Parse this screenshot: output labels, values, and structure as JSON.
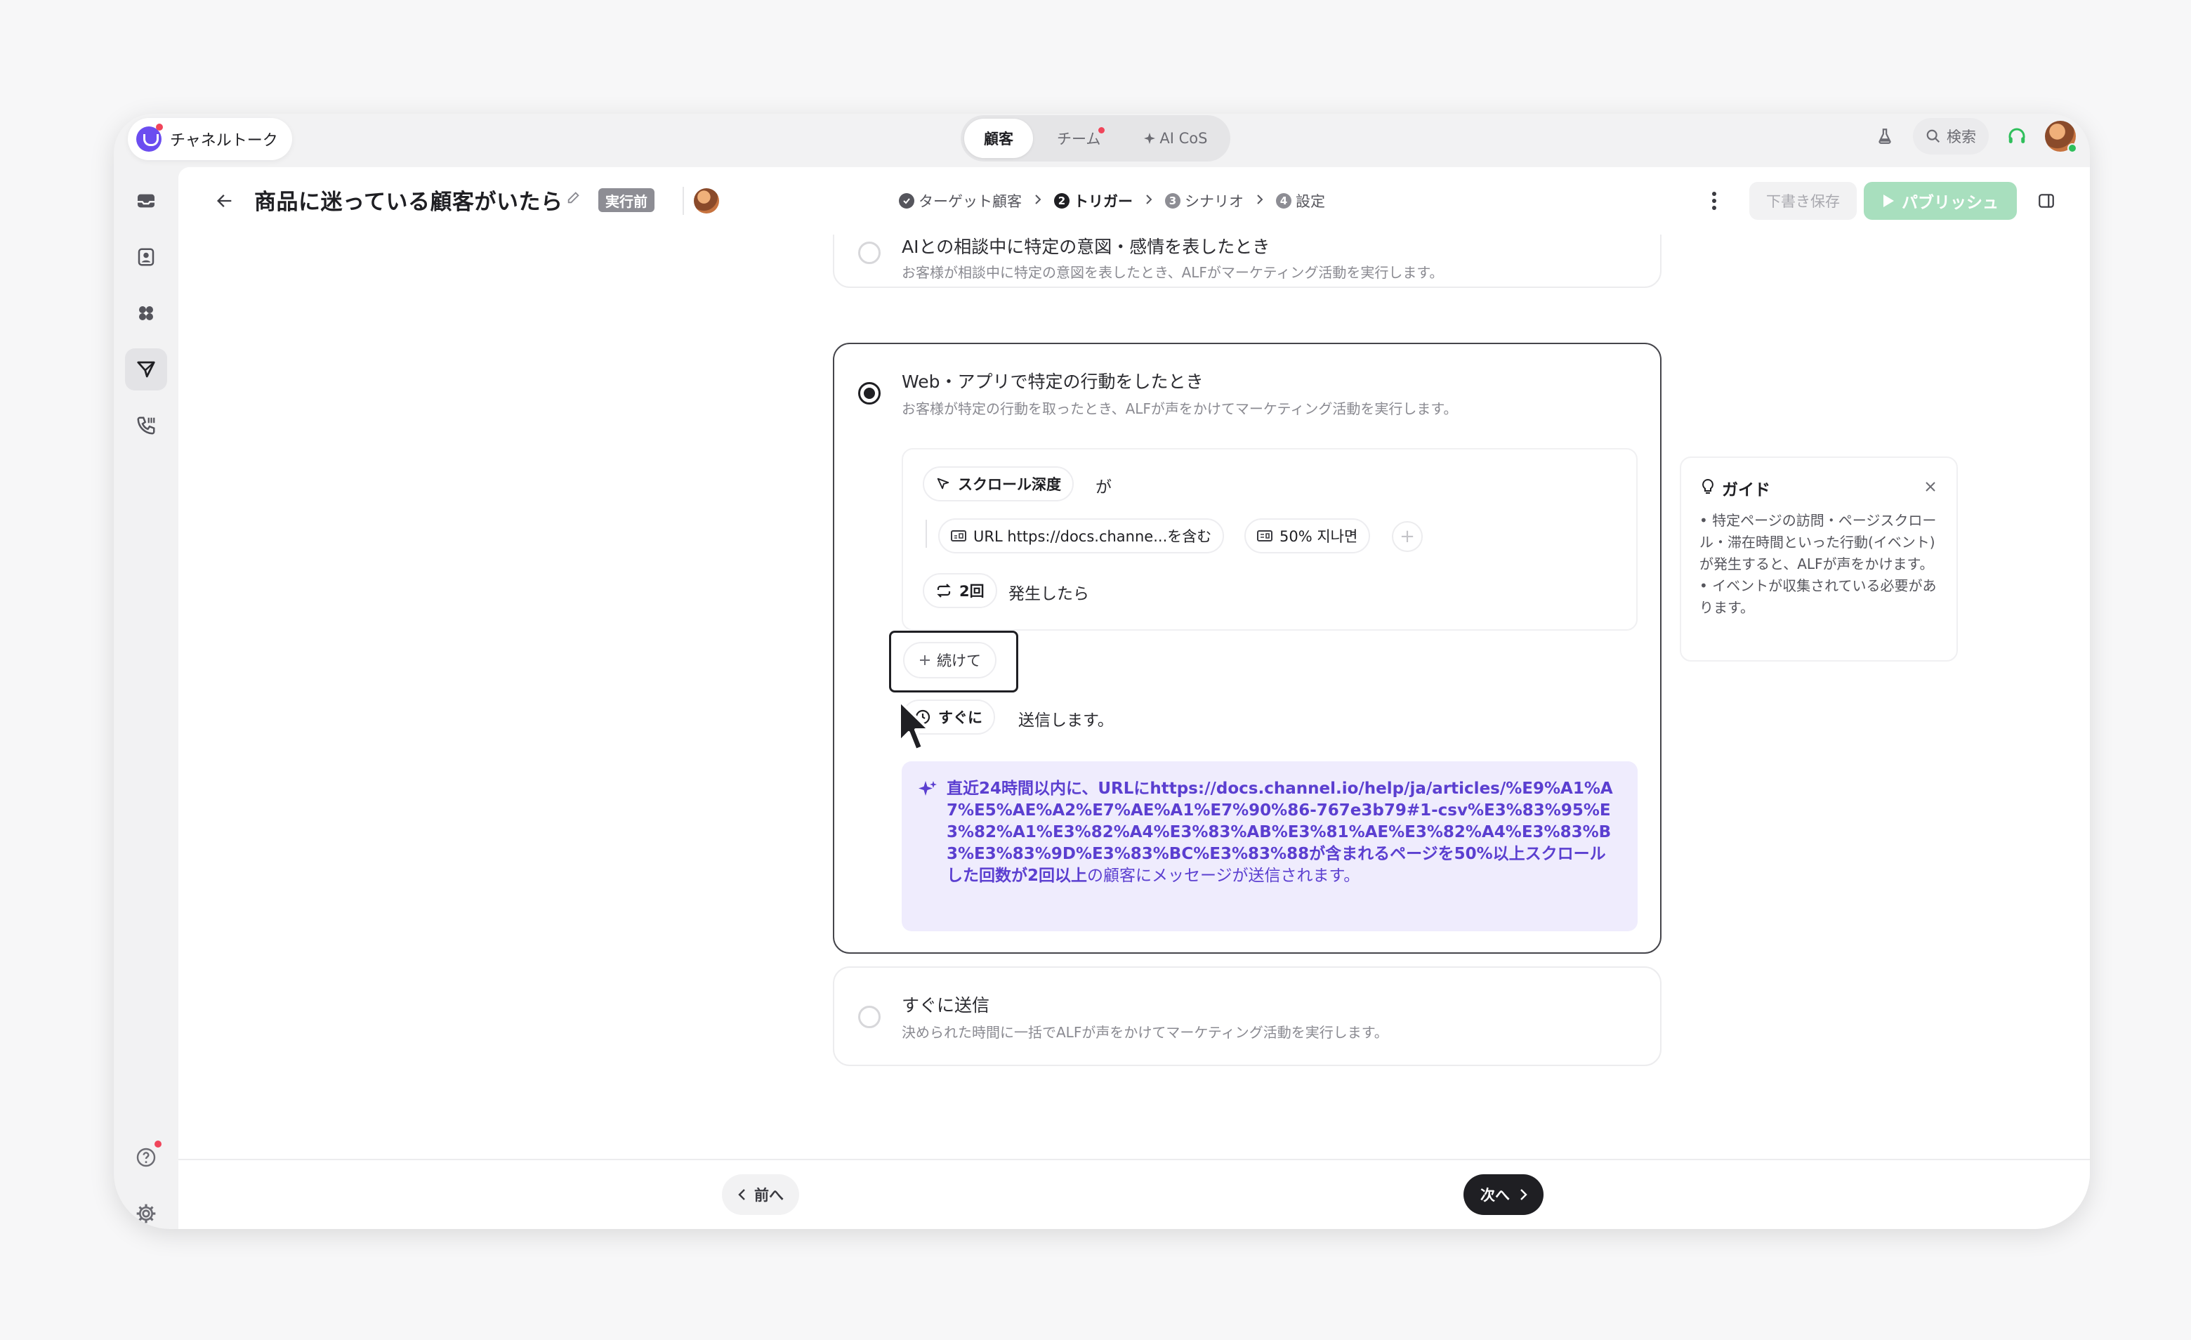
{
  "brand": {
    "name": "チャネルトーク"
  },
  "top_tabs": [
    {
      "label": "顧客",
      "active": true
    },
    {
      "label": "チーム",
      "has_dot": true
    },
    {
      "label": "AI CoS",
      "icon": "sparkle-icon"
    }
  ],
  "top_right": {
    "search_label": "検索"
  },
  "header": {
    "title": "商品に迷っている顧客がいたら",
    "status": "実行前",
    "steps": [
      {
        "label": "ターゲット顧客",
        "state": "done"
      },
      {
        "num": "2",
        "label": "トリガー",
        "state": "current"
      },
      {
        "num": "3",
        "label": "シナリオ",
        "state": "todo"
      },
      {
        "num": "4",
        "label": "設定",
        "state": "todo"
      }
    ],
    "draft_label": "下書き保存",
    "publish_label": "パブリッシュ"
  },
  "options": [
    {
      "title": "AIとの相談中に特定の意図・感情を表したとき",
      "desc": "お客様が相談中に特定の意図を表したとき、ALFがマーケティング活動を実行します。",
      "selected": false
    },
    {
      "title": "Web・アプリで特定の行動をしたとき",
      "desc": "お客様が特定の行動を取ったとき、ALFが声をかけてマーケティング活動を実行します。",
      "selected": true
    },
    {
      "title": "すぐに送信",
      "desc": "決められた時間に一括でALFが声をかけてマーケティング活動を実行します。",
      "selected": false
    }
  ],
  "condition": {
    "event_label": "スクロール深度",
    "event_suffix": "が",
    "filter_url": "URL https://docs.channe...を含む",
    "filter_depth": "50% 지나면",
    "count_label": "2回",
    "count_suffix": "発生したら",
    "continue_label": "続けて",
    "timing_label": "すぐに",
    "timing_suffix": "送信します。"
  },
  "summary": {
    "bold_part": "直近24時間以内に、URLにhttps://docs.channel.io/help/ja/articles/%E9%A1%A7%E5%AE%A2%E7%AE%A1%E7%90%86-767e3b79#1-csv%E3%83%95%E3%82%A1%E3%82%A4%E3%83%AB%E3%81%AE%E3%82%A4%E3%83%B3%E3%83%9D%E3%83%BC%E3%83%88が含まれるページを50%以上スクロールした回数が2回以上",
    "normal_part": "の顧客にメッセージが送信されます。"
  },
  "guide": {
    "title": "ガイド",
    "body_1": "• 特定ページの訪問・ページスクロール・滞在時間といった行動(イベント)が発生すると、ALFが声をかけます。",
    "body_2": "• イベントが収集されている必要があります。"
  },
  "footer": {
    "prev_label": "前へ",
    "next_label": "次へ"
  },
  "colors": {
    "accent": "#5b3fd0",
    "publish": "#a8dfbe",
    "brand": "#6b4df0",
    "alert": "#f0455a"
  }
}
